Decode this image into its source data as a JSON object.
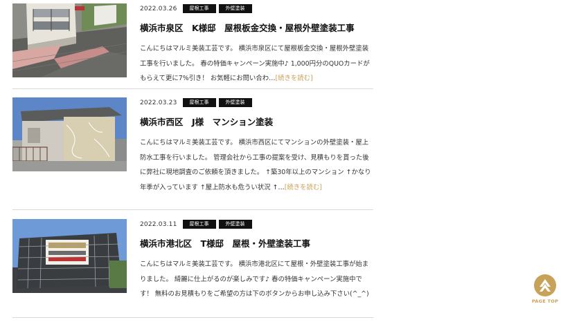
{
  "posts": [
    {
      "date": "2022.03.26",
      "tags": [
        "屋根工事",
        "外壁塗装"
      ],
      "title": "横浜市泉区　K様邸　屋根板金交換・屋根外壁塗装工事",
      "excerpt": "こんにちはマルミ美装工芸です。 横浜市泉区にて屋根板金交換・屋根外壁塗装工事を行いました。 春の特価キャンペーン実施中♪ 1,000円分のQUOカードがもらえて更に7%引き！ お気軽にお問い合わ…",
      "more": "[続きを読む]"
    },
    {
      "date": "2022.03.23",
      "tags": [
        "屋根工事",
        "外壁塗装"
      ],
      "title": "横浜市西区　J様　マンション塗装",
      "excerpt": "こんにちはマルミ美装工芸です。 横浜市西区にてマンションの外壁塗装・屋上防水工事を行いました。 管理会社から工事の提案を受け、見積もりを貰った後に弊社に現地調査のご依頼を頂きました。 ↑築30年以上のマンション ↑かなり年季が入っています ↑屋上防水も危うい状況 ↑…",
      "more": "[続きを読む]"
    },
    {
      "date": "2022.03.11",
      "tags": [
        "屋根工事",
        "外壁塗装"
      ],
      "title": "横浜市港北区　T様邸　屋根・外壁塗装工事",
      "excerpt": "こんにちはマルミ美装工芸です。 横浜市港北区にて屋根・外壁塗装工事が始まりました。 綺麗に仕上がるのが楽しみです♪ 春の特価キャンペーン実施中です！ 無料のお見積もりをご希望の方は下のボタンからお申し込み下さい(^_^)",
      "more": ""
    }
  ],
  "page_top": {
    "label": "PAGE TOP",
    "icon": "chevron-up-icon"
  },
  "colors": {
    "accent": "#c9a25a",
    "tag_bg": "#111111"
  }
}
